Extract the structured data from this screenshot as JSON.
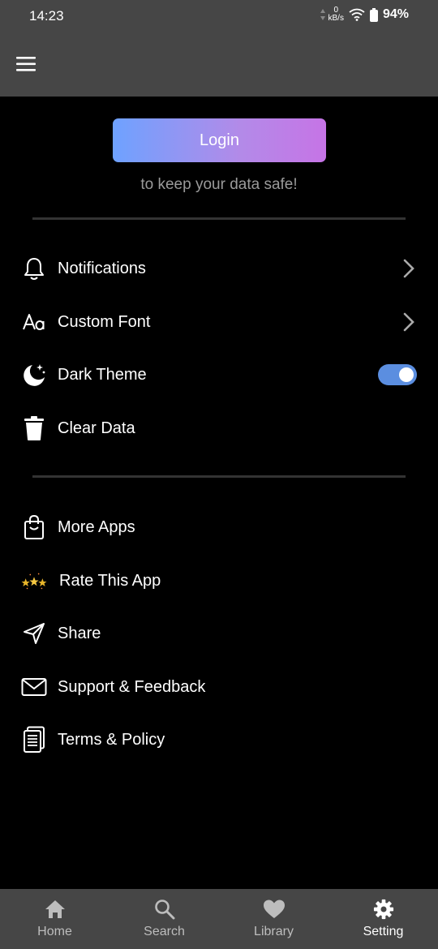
{
  "status_bar": {
    "time": "14:23",
    "net_speed_value": "0",
    "net_speed_unit": "kB/s",
    "battery": "94%"
  },
  "app_bar": {
    "menu_icon": "hamburger-menu-icon"
  },
  "login": {
    "button_label": "Login",
    "hint": "to keep your data safe!"
  },
  "settings": {
    "notifications": "Notifications",
    "custom_font": "Custom Font",
    "dark_theme": "Dark Theme",
    "dark_theme_enabled": true,
    "clear_data": "Clear Data"
  },
  "more": {
    "more_apps": "More Apps",
    "rate_app": "Rate This App",
    "share": "Share",
    "support": "Support & Feedback",
    "terms": "Terms & Policy"
  },
  "bottom_nav": {
    "tabs": [
      {
        "label": "Home",
        "icon": "home-icon"
      },
      {
        "label": "Search",
        "icon": "search-icon"
      },
      {
        "label": "Library",
        "icon": "heart-icon"
      },
      {
        "label": "Setting",
        "icon": "gear-icon",
        "active": true
      }
    ]
  },
  "colors": {
    "bar_bg": "#464646",
    "login_gradient_start": "#6ea2ff",
    "login_gradient_end": "#c674e6",
    "toggle_on": "#5b8ee0"
  }
}
